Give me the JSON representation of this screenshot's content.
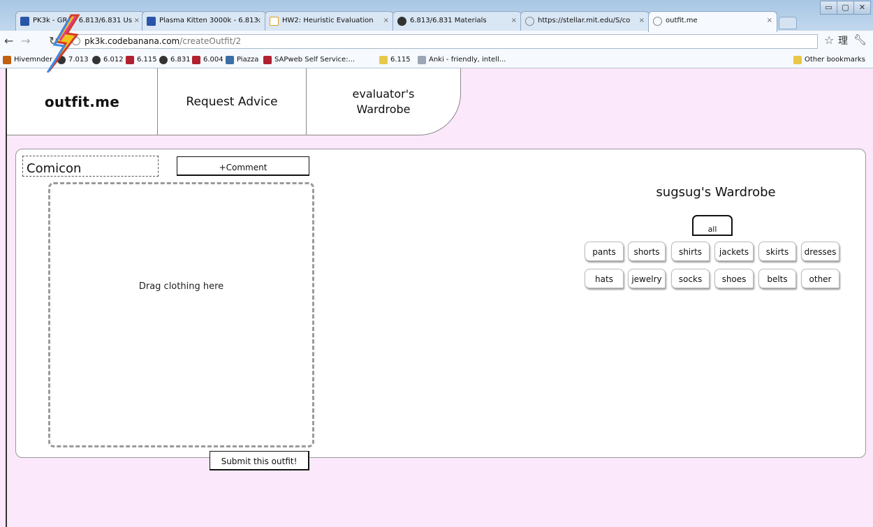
{
  "browser": {
    "tabs": [
      {
        "label": "PK3k - GR4 - 6.813/6.831 Us",
        "icon": "star-icon",
        "color": "#2a55a8"
      },
      {
        "label": "Plasma Kitten 3000k - 6.813.",
        "icon": "star-icon",
        "color": "#2a55a8"
      },
      {
        "label": "HW2: Heuristic Evaluation",
        "icon": "doc-icon",
        "color": "#e0a020"
      },
      {
        "label": "6.813/6.831 Materials",
        "icon": "stellar-icon",
        "color": "#333333"
      },
      {
        "label": "https://stellar.mit.edu/S/co",
        "icon": "globe-icon",
        "color": "#888888"
      },
      {
        "label": "outfit.me",
        "icon": "globe-icon",
        "color": "#888888"
      }
    ],
    "url_host": "pk3k.codebanana.com",
    "url_path": "/createOutfit/2",
    "bookmarks": [
      {
        "label": "Hivemnder",
        "color": "#c06010"
      },
      {
        "label": "7.013",
        "color": "#333333"
      },
      {
        "label": "6.012",
        "color": "#333333"
      },
      {
        "label": "6.115",
        "color": "#b02030"
      },
      {
        "label": "6.831",
        "color": "#333333"
      },
      {
        "label": "6.004",
        "color": "#b02030"
      },
      {
        "label": "Piazza",
        "color": "#3a6ea5"
      },
      {
        "label": "SAPweb Self Service:...",
        "color": "#b02030"
      },
      {
        "label": "6.115",
        "color": "#e8c84a"
      },
      {
        "label": "Anki - friendly, intell...",
        "color": "#9aa6b4"
      }
    ],
    "other_bookmarks": "Other bookmarks",
    "kanji": "理"
  },
  "nav": {
    "brand": "outfit.me",
    "request_advice": "Request Advice",
    "wardrobe_line1": "evaluator's",
    "wardrobe_line2": "Wardrobe"
  },
  "outfit": {
    "name": "Comicon",
    "comment_label": "+Comment",
    "drop_text": "Drag clothing here",
    "submit_label": "Submit this outfit!"
  },
  "wardrobe": {
    "title": "sugsug's Wardrobe",
    "all_label": "all",
    "row1": [
      "pants",
      "shorts",
      "shirts",
      "jackets",
      "skirts",
      "dresses"
    ],
    "row2": [
      "hats",
      "jewelry",
      "socks",
      "shoes",
      "belts",
      "other"
    ]
  },
  "colors": {
    "page_bg": "#fce8fb",
    "panel_bg": "#ffffff",
    "chrome_bg": "#c7dbef"
  }
}
